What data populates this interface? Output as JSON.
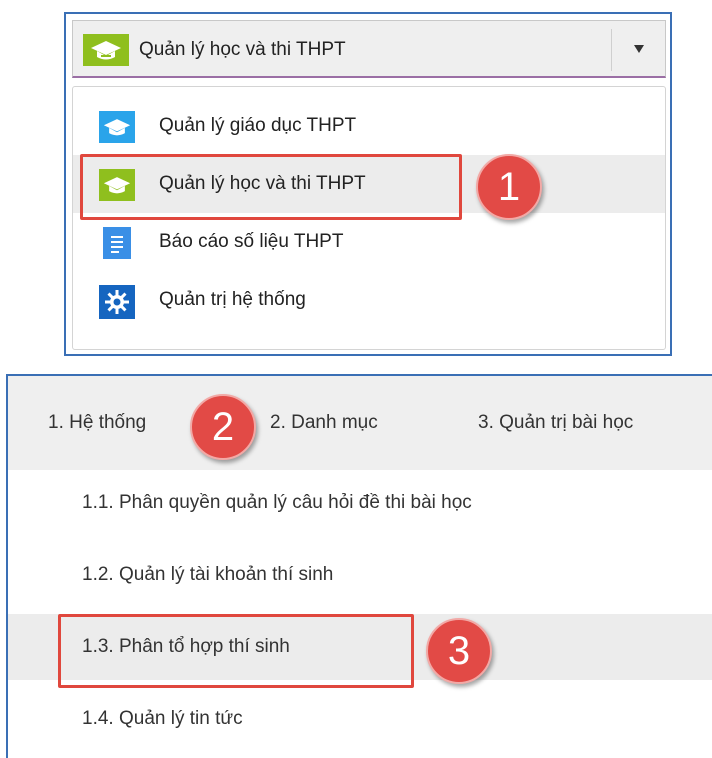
{
  "module_selector": {
    "selected_label": "Quản lý học và thi THPT",
    "selected_icon": "graduation-cap-icon",
    "options": [
      {
        "label": "Quản lý giáo dục THPT",
        "icon": "graduation-cap-icon",
        "color": "#2aa4ea"
      },
      {
        "label": "Quản lý học và thi THPT",
        "icon": "graduation-cap-icon",
        "color": "#8fbf1e",
        "selected": true
      },
      {
        "label": "Báo cáo số liệu THPT",
        "icon": "document-icon",
        "color": "#3a8fe6"
      },
      {
        "label": "Quản trị hệ thống",
        "icon": "gear-icon",
        "color": "#1565c0"
      }
    ]
  },
  "top_menu": {
    "items": [
      {
        "label": "1. Hệ thống"
      },
      {
        "label": "2. Danh mục"
      },
      {
        "label": "3. Quản trị bài học"
      }
    ],
    "submenu": [
      {
        "label": "1.1. Phân quyền quản lý câu hỏi đề thi bài học"
      },
      {
        "label": "1.2. Quản lý tài khoản thí sinh"
      },
      {
        "label": "1.3. Phân tổ hợp thí sinh",
        "highlighted": true
      },
      {
        "label": "1.4. Quản lý tin tức"
      }
    ]
  },
  "annotations": {
    "step1": "1",
    "step2": "2",
    "step3": "3",
    "highlight_color": "#e0473d",
    "badge_color": "#e24a46"
  },
  "colors": {
    "frame_border": "#3a6fb5",
    "menu_bg": "#efefef",
    "selected_row": "#ececec"
  }
}
